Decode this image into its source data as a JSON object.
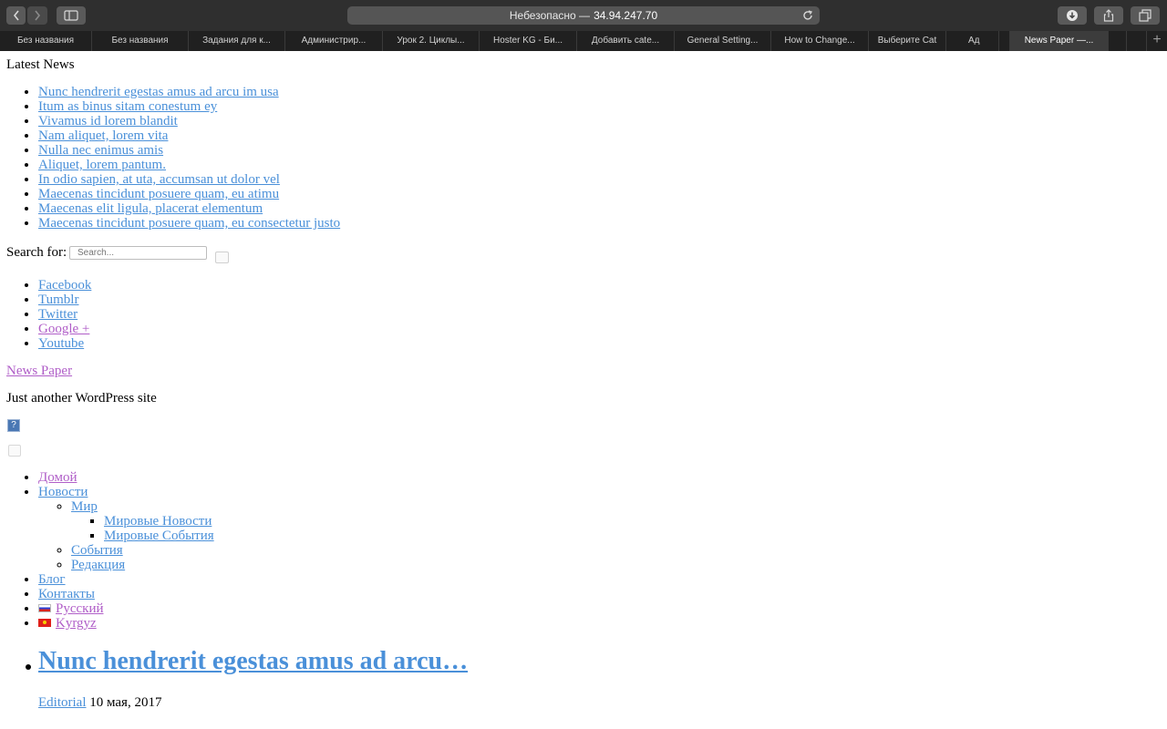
{
  "browser": {
    "address_prefix": "Небезопасно —",
    "address_host": "34.94.247.70",
    "tabs": [
      "Без названия",
      "Без названия",
      "Задания для к...",
      "Администрир...",
      "Урок 2. Циклы...",
      "Hoster KG - Би...",
      "Добавить cate...",
      "General Setting...",
      "How to Change...",
      "Выберите Cat",
      "Ад",
      "News Paper —..."
    ],
    "active_tab_index": 11,
    "icons": [
      "back-icon",
      "forward-icon",
      "sidebar-icon",
      "reload-icon",
      "download-icon",
      "share-icon",
      "tabs-overview-icon",
      "new-tab-icon"
    ]
  },
  "latest_news": {
    "heading": "Latest News",
    "items": [
      "Nunc hendrerit egestas amus ad arcu im usa",
      "Itum as binus sitam conestum ey",
      "Vivamus id lorem blandit",
      "Nam aliquet, lorem vita",
      "Nulla nec enimus amis",
      "Aliquet, lorem pantum.",
      "In odio sapien, at uta, accumsan ut dolor vel",
      "Maecenas tincidunt posuere quam, eu atimu",
      "Maecenas elit ligula, placerat elementum",
      "Maecenas tincidunt posuere quam, eu consectetur justo"
    ]
  },
  "search": {
    "label": "Search for:",
    "placeholder": "Search..."
  },
  "social": [
    "Facebook",
    "Tumblr",
    "Twitter",
    "Google +",
    "Youtube"
  ],
  "site": {
    "title": "News Paper",
    "tagline": "Just another WordPress site"
  },
  "menu": {
    "home": "Домой",
    "news": "Новости",
    "world": "Мир",
    "world_news": "Мировые Новости",
    "world_events": "Мировые События",
    "events": "События",
    "editorial": "Редакция",
    "blog": "Блог",
    "contacts": "Контакты",
    "lang_ru": "Русский",
    "lang_kg": "Kyrgyz"
  },
  "post": {
    "title": "Nunc hendrerit egestas amus ad arcu…",
    "category": "Editorial",
    "date": "10 мая, 2017"
  },
  "colors": {
    "link": "#4a90d9",
    "visited_link": "#b05ec8",
    "chrome_bg": "#2f2f2f"
  }
}
